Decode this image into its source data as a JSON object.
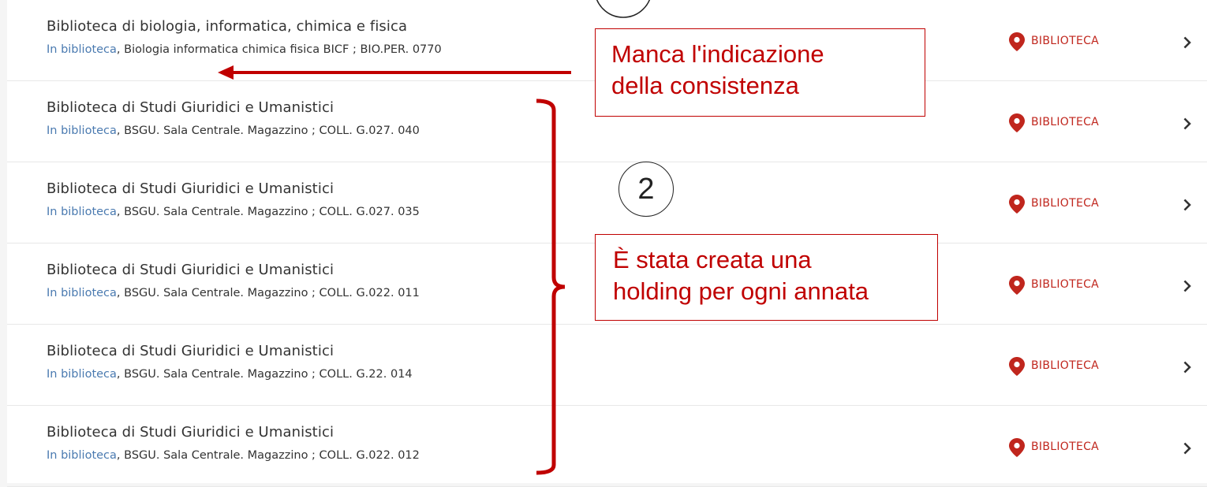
{
  "holdings": [
    {
      "library": "Biblioteca di biologia, informatica, chimica e fisica",
      "availability": "In biblioteca",
      "location": ", Biologia informatica chimica fisica BICF ; BIO.PER. 0770",
      "location_label": "BIBLIOTECA"
    },
    {
      "library": "Biblioteca di Studi Giuridici e Umanistici",
      "availability": "In biblioteca",
      "location": ", BSGU. Sala Centrale. Magazzino ; COLL. G.027. 040",
      "location_label": "BIBLIOTECA"
    },
    {
      "library": "Biblioteca di Studi Giuridici e Umanistici",
      "availability": "In biblioteca",
      "location": ", BSGU. Sala Centrale. Magazzino ; COLL. G.027. 035",
      "location_label": "BIBLIOTECA"
    },
    {
      "library": "Biblioteca di Studi Giuridici e Umanistici",
      "availability": "In biblioteca",
      "location": ", BSGU. Sala Centrale. Magazzino ; COLL. G.022. 011",
      "location_label": "BIBLIOTECA"
    },
    {
      "library": "Biblioteca di Studi Giuridici e Umanistici",
      "availability": "In biblioteca",
      "location": ", BSGU. Sala Centrale. Magazzino ; COLL. G.22. 014",
      "location_label": "BIBLIOTECA"
    },
    {
      "library": "Biblioteca di Studi Giuridici e Umanistici",
      "availability": "In biblioteca",
      "location": ", BSGU. Sala Centrale. Magazzino ; COLL. G.022. 012",
      "location_label": "BIBLIOTECA"
    }
  ],
  "annotations": {
    "callout_1": {
      "line1": "Manca l'indicazione",
      "line2": "della consistenza"
    },
    "callout_2": {
      "line1": "È stata creata una",
      "line2": "holding per ogni annata"
    },
    "marker_2": "2"
  },
  "icons": {
    "location": "map-pin-icon",
    "row_action": "chevron-right-icon"
  },
  "colors": {
    "accent_red": "#c0261d",
    "annotation_red": "#c00000",
    "link_blue": "#4a7ab0"
  }
}
